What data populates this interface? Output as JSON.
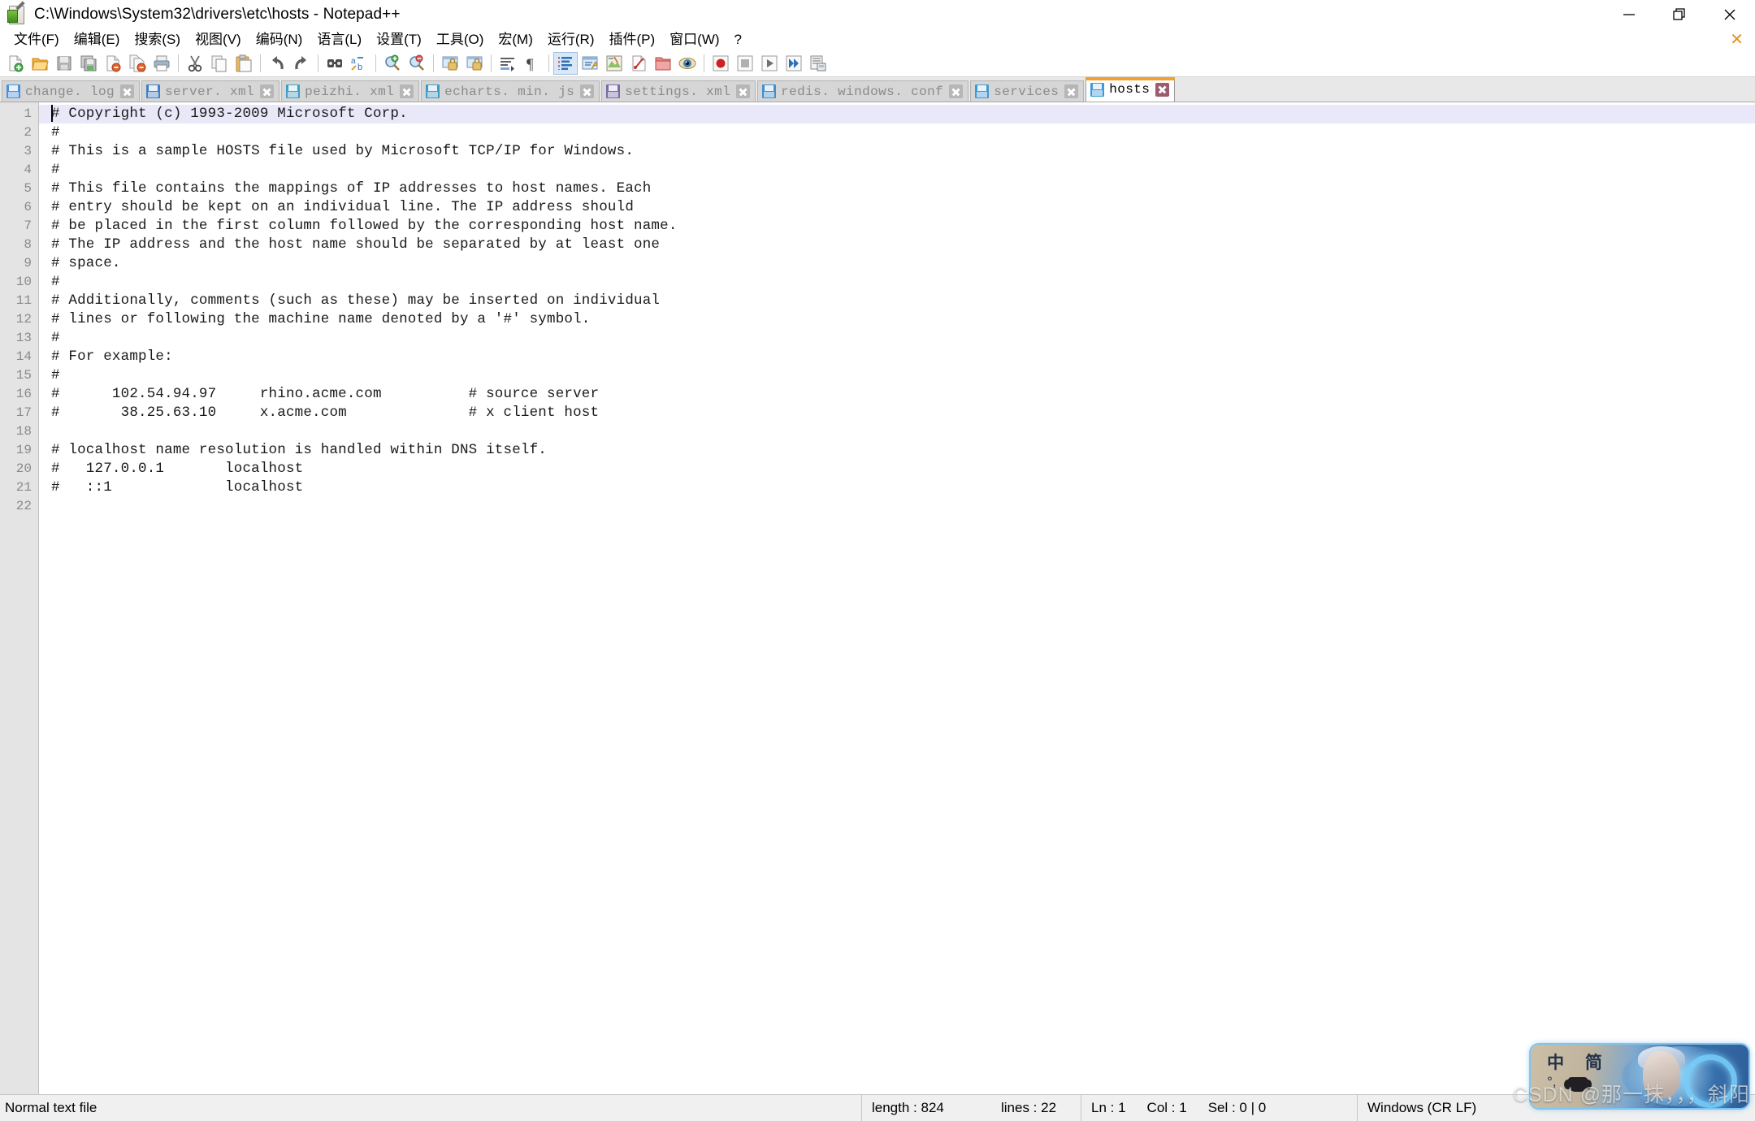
{
  "window": {
    "title": "C:\\Windows\\System32\\drivers\\etc\\hosts - Notepad++",
    "app_icon": "notepad-plus-plus-icon",
    "controls": {
      "minimize": "minimize-icon",
      "restore": "restore-icon",
      "close": "close-icon",
      "document_close": "✕"
    }
  },
  "menubar": {
    "items": [
      {
        "label": "文件(F)",
        "name": "menu-file"
      },
      {
        "label": "编辑(E)",
        "name": "menu-edit"
      },
      {
        "label": "搜索(S)",
        "name": "menu-search"
      },
      {
        "label": "视图(V)",
        "name": "menu-view"
      },
      {
        "label": "编码(N)",
        "name": "menu-encoding"
      },
      {
        "label": "语言(L)",
        "name": "menu-language"
      },
      {
        "label": "设置(T)",
        "name": "menu-settings"
      },
      {
        "label": "工具(O)",
        "name": "menu-tools"
      },
      {
        "label": "宏(M)",
        "name": "menu-macro"
      },
      {
        "label": "运行(R)",
        "name": "menu-run"
      },
      {
        "label": "插件(P)",
        "name": "menu-plugins"
      },
      {
        "label": "窗口(W)",
        "name": "menu-window"
      },
      {
        "label": "?",
        "name": "menu-help"
      }
    ]
  },
  "toolbar": {
    "buttons": [
      {
        "name": "new-file-icon"
      },
      {
        "name": "open-file-icon"
      },
      {
        "name": "save-icon"
      },
      {
        "name": "save-all-icon"
      },
      {
        "name": "close-file-icon"
      },
      {
        "name": "close-all-files-icon"
      },
      {
        "name": "print-icon"
      },
      {
        "name": "cut-icon"
      },
      {
        "name": "copy-icon"
      },
      {
        "name": "paste-icon"
      },
      {
        "name": "undo-icon"
      },
      {
        "name": "redo-icon"
      },
      {
        "name": "find-icon"
      },
      {
        "name": "replace-icon"
      },
      {
        "name": "zoom-in-icon"
      },
      {
        "name": "zoom-out-icon"
      },
      {
        "name": "sync-vertical-scroll-icon"
      },
      {
        "name": "sync-horizontal-scroll-icon"
      },
      {
        "name": "word-wrap-icon"
      },
      {
        "name": "show-all-characters-icon"
      },
      {
        "name": "indent-guide-icon"
      },
      {
        "name": "user-defined-language-icon"
      },
      {
        "name": "document-map-icon"
      },
      {
        "name": "function-list-icon"
      },
      {
        "name": "folder-as-workspace-icon"
      },
      {
        "name": "monitoring-icon"
      },
      {
        "name": "record-macro-icon"
      },
      {
        "name": "stop-macro-icon"
      },
      {
        "name": "play-macro-icon"
      },
      {
        "name": "run-macro-multiple-icon"
      },
      {
        "name": "save-macro-icon"
      }
    ]
  },
  "tabs": [
    {
      "label": "change. log",
      "active": false,
      "icon_color": "#4a90d9"
    },
    {
      "label": "server. xml",
      "active": false,
      "icon_color": "#3f7fc4"
    },
    {
      "label": "peizhi. xml",
      "active": false,
      "icon_color": "#3fa0c4"
    },
    {
      "label": "echarts. min. js",
      "active": false,
      "icon_color": "#3f9ac4"
    },
    {
      "label": "settings. xml",
      "active": false,
      "icon_color": "#7a6aa8"
    },
    {
      "label": "redis. windows. conf",
      "active": false,
      "icon_color": "#3f8fd0"
    },
    {
      "label": "services",
      "active": false,
      "icon_color": "#3f9ad6"
    },
    {
      "label": "hosts",
      "active": true,
      "icon_color": "#3f9ad6"
    }
  ],
  "editor": {
    "current_line": 1,
    "lines": [
      {
        "n": "1",
        "text": "# Copyright (c) 1993-2009 Microsoft Corp."
      },
      {
        "n": "2",
        "text": "#"
      },
      {
        "n": "3",
        "text": "# This is a sample HOSTS file used by Microsoft TCP/IP for Windows."
      },
      {
        "n": "4",
        "text": "#"
      },
      {
        "n": "5",
        "text": "# This file contains the mappings of IP addresses to host names. Each"
      },
      {
        "n": "6",
        "text": "# entry should be kept on an individual line. The IP address should"
      },
      {
        "n": "7",
        "text": "# be placed in the first column followed by the corresponding host name."
      },
      {
        "n": "8",
        "text": "# The IP address and the host name should be separated by at least one"
      },
      {
        "n": "9",
        "text": "# space."
      },
      {
        "n": "10",
        "text": "#"
      },
      {
        "n": "11",
        "text": "# Additionally, comments (such as these) may be inserted on individual"
      },
      {
        "n": "12",
        "text": "# lines or following the machine name denoted by a '#' symbol."
      },
      {
        "n": "13",
        "text": "#"
      },
      {
        "n": "14",
        "text": "# For example:"
      },
      {
        "n": "15",
        "text": "#"
      },
      {
        "n": "16",
        "text": "#      102.54.94.97     rhino.acme.com          # source server"
      },
      {
        "n": "17",
        "text": "#       38.25.63.10     x.acme.com              # x client host"
      },
      {
        "n": "18",
        "text": ""
      },
      {
        "n": "19",
        "text": "# localhost name resolution is handled within DNS itself."
      },
      {
        "n": "20",
        "text": "#   127.0.0.1       localhost"
      },
      {
        "n": "21",
        "text": "#   ::1             localhost"
      },
      {
        "n": "22",
        "text": ""
      }
    ]
  },
  "statusbar": {
    "doc_type": "Normal text file",
    "length": "length : 824",
    "lines": "lines : 22",
    "ln": "Ln : 1",
    "col": "Col : 1",
    "sel": "Sel : 0 | 0",
    "eol": "Windows (CR LF)"
  },
  "overlay": {
    "ime_mode": "中 简",
    "ime_punct": "°,",
    "watermark": "CSDN @那一抹，，，斜阳"
  },
  "colors": {
    "active_tab_top": "#f0a132",
    "tabbar_bg": "#e8e8e8",
    "gutter_bg": "#e4e4e4",
    "current_line_bg": "#e8e8f8",
    "statusbar_bg": "#f0f0f0"
  }
}
